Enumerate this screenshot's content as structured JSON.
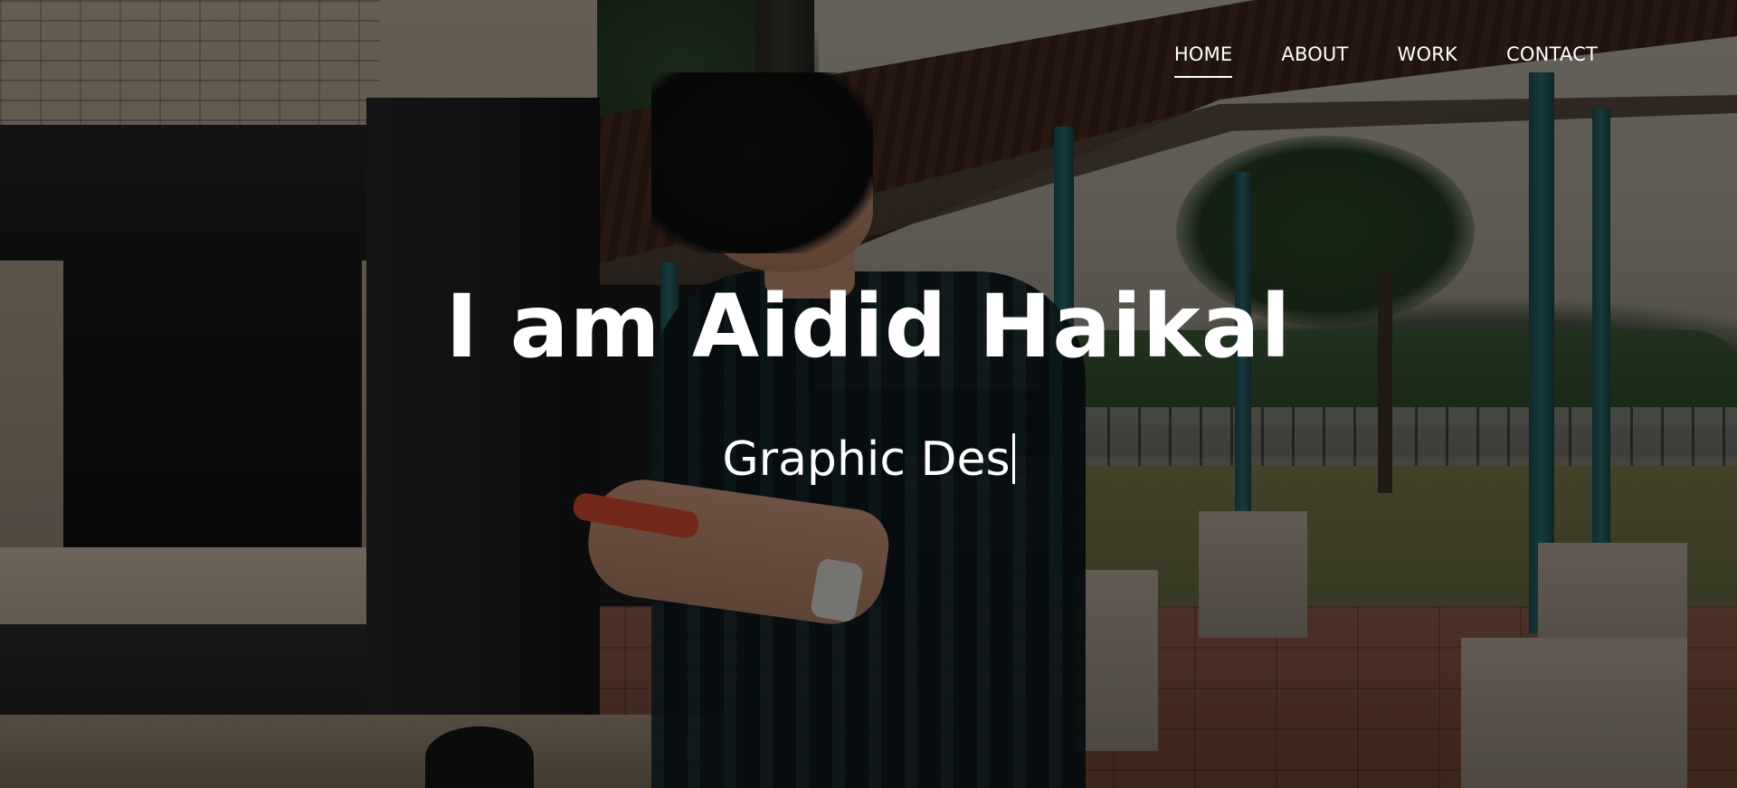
{
  "nav": {
    "items": [
      {
        "label": "HOME",
        "active": true
      },
      {
        "label": "ABOUT",
        "active": false
      },
      {
        "label": "WORK",
        "active": false
      },
      {
        "label": "CONTACT",
        "active": false
      }
    ]
  },
  "hero": {
    "title": "I am Aidid Haikal",
    "typed_text": "Graphic Des"
  },
  "colors": {
    "text": "#ffffff",
    "overlay": "rgba(0,0,0,0.45)"
  }
}
